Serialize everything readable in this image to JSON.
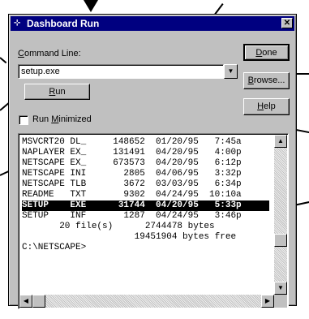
{
  "window": {
    "title": "Dashboard Run",
    "close_glyph": "✕",
    "icon": "run-icon"
  },
  "command_line": {
    "label_underlined": "C",
    "label_rest": "ommand Line:",
    "value": "setup.exe",
    "dropdown_glyph": "▼"
  },
  "buttons": {
    "done_u": "D",
    "done_rest": "one",
    "browse_u": "B",
    "browse_rest": "rowse...",
    "help_u": "H",
    "help_rest": "elp",
    "run_u": "R",
    "run_rest": "un"
  },
  "run_minimized": {
    "label_pre": "Run ",
    "label_u": "M",
    "label_rest": "inimized",
    "checked": false
  },
  "console": {
    "lines": [
      "MSVCRT20 DL_     148652  01/20/95   7:45a",
      "NAPLAYER EX_     131491  04/20/95   4:00p",
      "NETSCAPE EX_     673573  04/20/95   6:12p",
      "NETSCAPE INI       2805  04/06/95   3:32p",
      "NETSCAPE TLB       3672  03/03/95   6:34p",
      "README   TXT       9302  04/24/95  10:10a",
      "SETUP    EXE      31744  04/20/95   5:33p",
      "SETUP    INF       1287  04/24/95   3:46p",
      "       20 file(s)      2744478 bytes",
      "                     19451904 bytes free",
      "C:\\NETSCAPE>"
    ],
    "selected_index": 6
  },
  "scrollbars": {
    "up_glyph": "▲",
    "down_glyph": "▼",
    "left_glyph": "◀",
    "right_glyph": "▶"
  }
}
